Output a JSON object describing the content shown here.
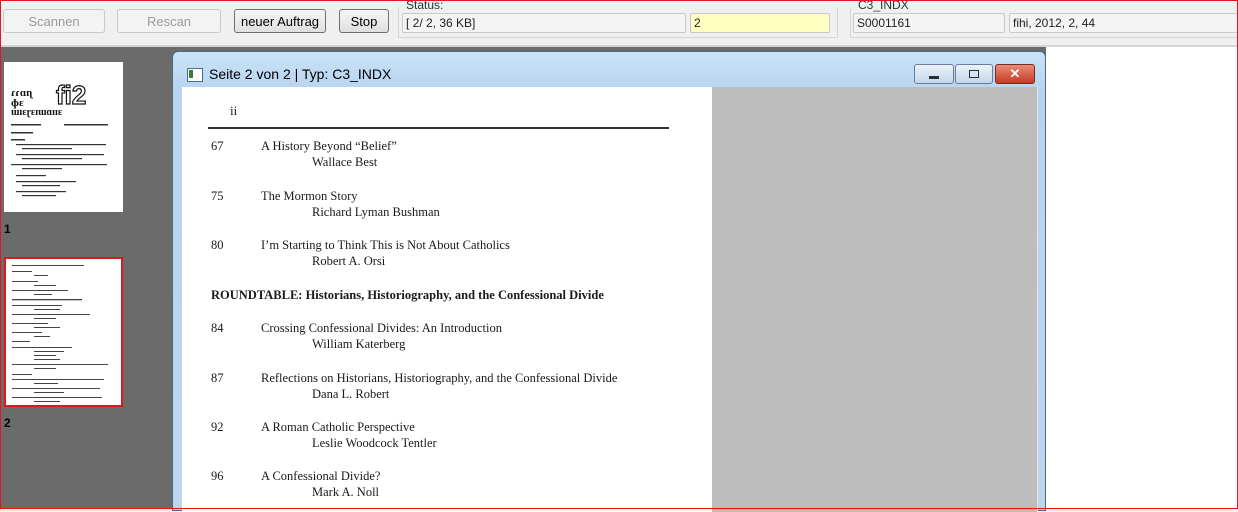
{
  "toolbar": {
    "scan_label": "Scannen",
    "rescan_label": "Rescan",
    "new_job_label": "neuer Auftrag",
    "stop_label": "Stop"
  },
  "status": {
    "label": "Status:",
    "progress": "[ 2/ 2,  36 KB]",
    "page_value": "2"
  },
  "index": {
    "label": "C3_INDX",
    "id": "S0001161",
    "meta": "fihi, 2012, 2, 44"
  },
  "thumbnails": [
    {
      "number": "1",
      "selected": false
    },
    {
      "number": "2",
      "selected": true
    }
  ],
  "window": {
    "title": "Seite 2 von 2 | Typ: C3_INDX"
  },
  "document": {
    "roman": "ii",
    "entries": [
      {
        "num": "67",
        "title": "A History Beyond “Belief”",
        "author": "Wallace Best"
      },
      {
        "num": "75",
        "title": "The Mormon Story",
        "author": "Richard Lyman Bushman"
      },
      {
        "num": "80",
        "title": "I’m Starting to Think This is Not About Catholics",
        "author": "Robert A. Orsi"
      },
      {
        "num": "84",
        "title": "Crossing Confessional Divides: An Introduction",
        "author": "William Katerberg"
      },
      {
        "num": "87",
        "title": "Reflections on Historians, Historiography, and the Confessional Divide",
        "author": "Dana L. Robert"
      },
      {
        "num": "92",
        "title": "A Roman Catholic Perspective",
        "author": "Leslie Woodcock Tentler"
      },
      {
        "num": "96",
        "title": "A Confessional Divide?",
        "author": "Mark A. Noll"
      }
    ],
    "section_heading": "ROUNDTABLE: Historians, Historiography, and the Confessional Divide"
  },
  "colors": {
    "selection_border": "#e0161b",
    "page_field_bg": "#ffffc2",
    "viewer_bg": "#6b6b6b"
  }
}
